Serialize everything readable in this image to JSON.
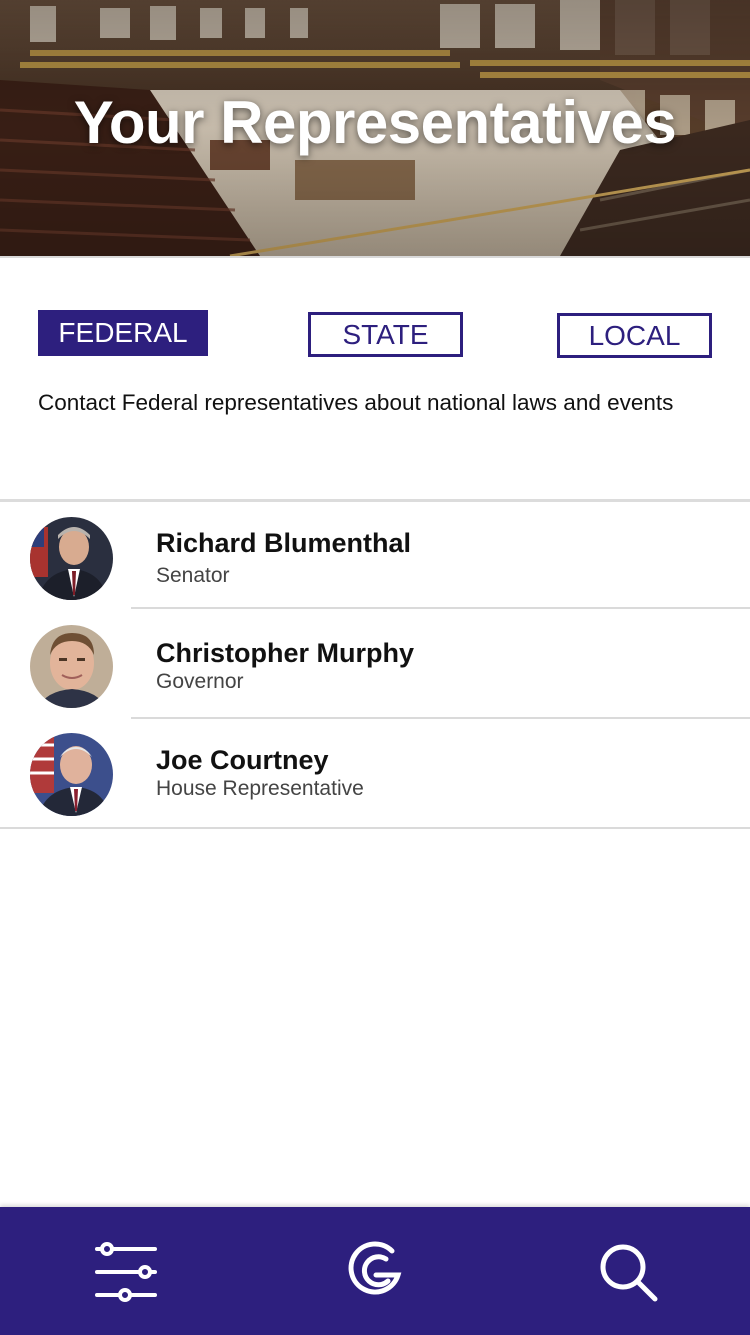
{
  "header": {
    "title": "Your Representatives",
    "background": "legislative-chamber-photo"
  },
  "tabs": [
    {
      "label": "FEDERAL",
      "active": true
    },
    {
      "label": "STATE",
      "active": false
    },
    {
      "label": "LOCAL",
      "active": false
    }
  ],
  "description": "Contact Federal representatives about national laws and events",
  "representatives": [
    {
      "name": "Richard Blumenthal",
      "role": "Senator",
      "photo": "avatar-photo"
    },
    {
      "name": "Christopher Murphy",
      "role": "Governor",
      "photo": "avatar-photo"
    },
    {
      "name": "Joe Courtney",
      "role": "House Representative",
      "photo": "avatar-photo"
    }
  ],
  "nav": [
    {
      "icon": "sliders-icon"
    },
    {
      "icon": "g-logo-icon"
    },
    {
      "icon": "search-icon"
    }
  ],
  "colors": {
    "accent": "#2d1f7e",
    "divider": "#dcdcdc",
    "background": "#ffffff"
  }
}
